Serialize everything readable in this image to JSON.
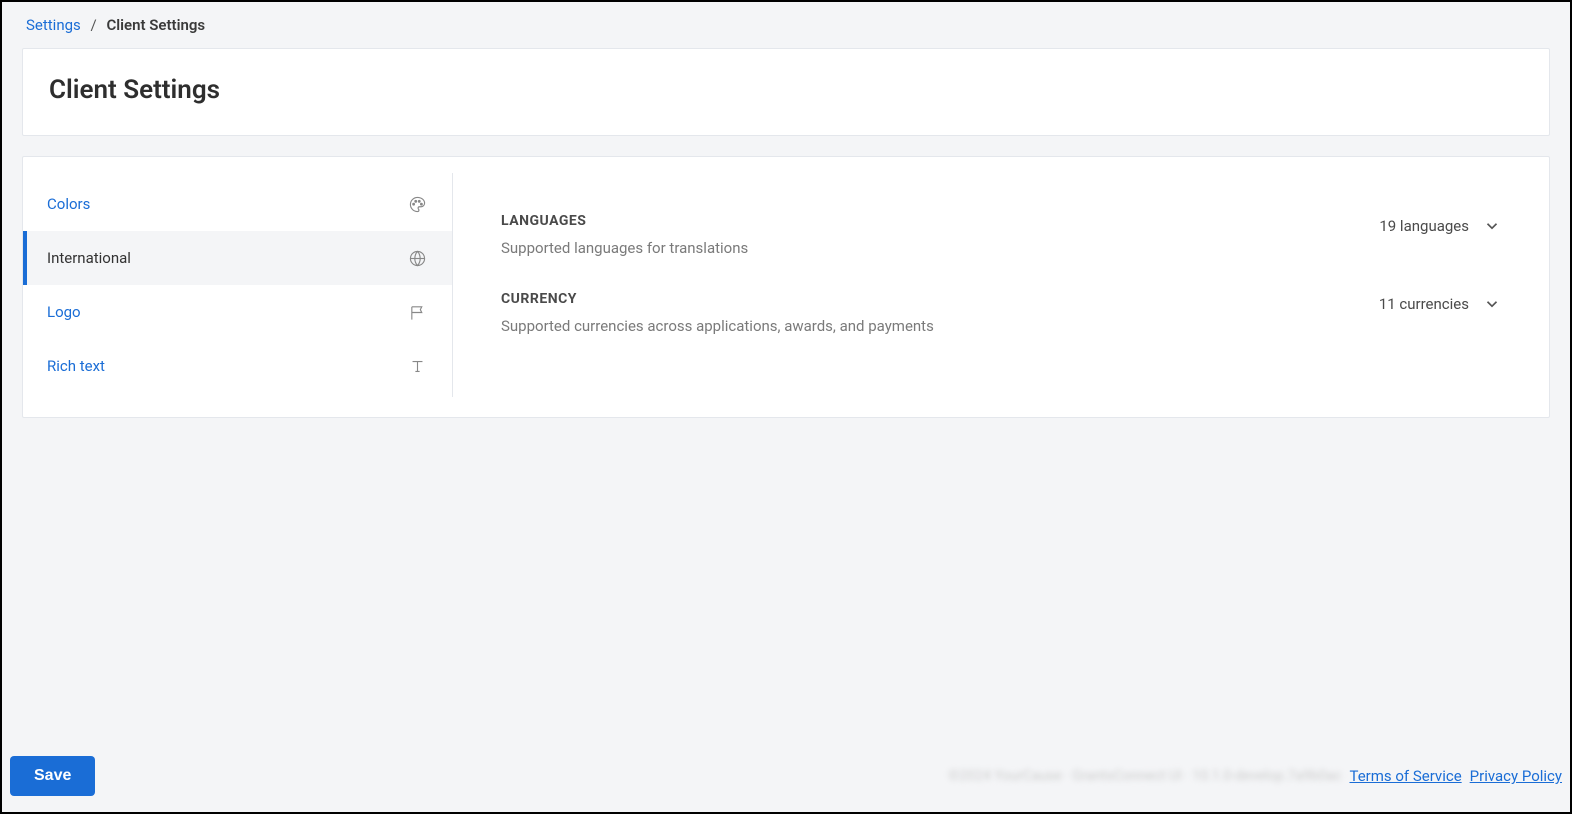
{
  "breadcrumb": {
    "root": "Settings",
    "current": "Client Settings"
  },
  "page": {
    "title": "Client Settings"
  },
  "sidebar": {
    "items": [
      {
        "label": "Colors",
        "icon": "palette-icon",
        "active": false
      },
      {
        "label": "International",
        "icon": "globe-icon",
        "active": true
      },
      {
        "label": "Logo",
        "icon": "flag-icon",
        "active": false
      },
      {
        "label": "Rich text",
        "icon": "text-icon",
        "active": false
      }
    ]
  },
  "sections": {
    "languages": {
      "title": "LANGUAGES",
      "desc": "Supported languages for translations",
      "summary": "19 languages"
    },
    "currency": {
      "title": "CURRENCY",
      "desc": "Supported currencies across applications, awards, and payments",
      "summary": "11 currencies"
    }
  },
  "footer": {
    "save": "Save",
    "copyright": "©2024 YourCause · GrantsConnect UI · 10.1.0-develop.7a9b0ac",
    "terms": "Terms of Service",
    "privacy": "Privacy Policy"
  }
}
